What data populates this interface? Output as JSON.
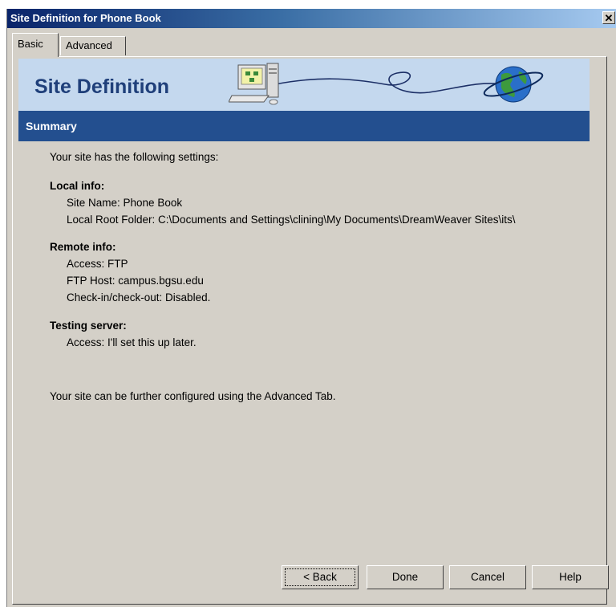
{
  "window": {
    "title": "Site Definition for Phone Book",
    "close_glyph": "✕"
  },
  "tabs": [
    {
      "label": "Basic",
      "active": true
    },
    {
      "label": "Advanced",
      "active": false
    }
  ],
  "banner": {
    "title": "Site Definition",
    "icons": [
      "computer-icon",
      "globe-icon"
    ]
  },
  "section": {
    "title": "Summary"
  },
  "summary": {
    "intro": "Your site has the following settings:",
    "local_heading": "Local info:",
    "site_name": "Site Name: Phone Book",
    "local_root": "Local Root Folder: C:\\Documents and Settings\\clining\\My Documents\\DreamWeaver Sites\\its\\",
    "remote_heading": "Remote info:",
    "remote_access": "Access: FTP",
    "ftp_host": "FTP Host: campus.bgsu.edu",
    "checkin": "Check-in/check-out: Disabled.",
    "testing_heading": "Testing server:",
    "testing_access": "Access: I'll set this up later.",
    "footer": "Your site can be further configured using the Advanced Tab."
  },
  "buttons": {
    "back": "< Back",
    "done": "Done",
    "cancel": "Cancel",
    "help": "Help"
  },
  "colors": {
    "titlebar": "#0a246a",
    "banner": "#c4d8ee",
    "summary_bar": "#234f8f",
    "dialog_bg": "#d4d0c8"
  }
}
